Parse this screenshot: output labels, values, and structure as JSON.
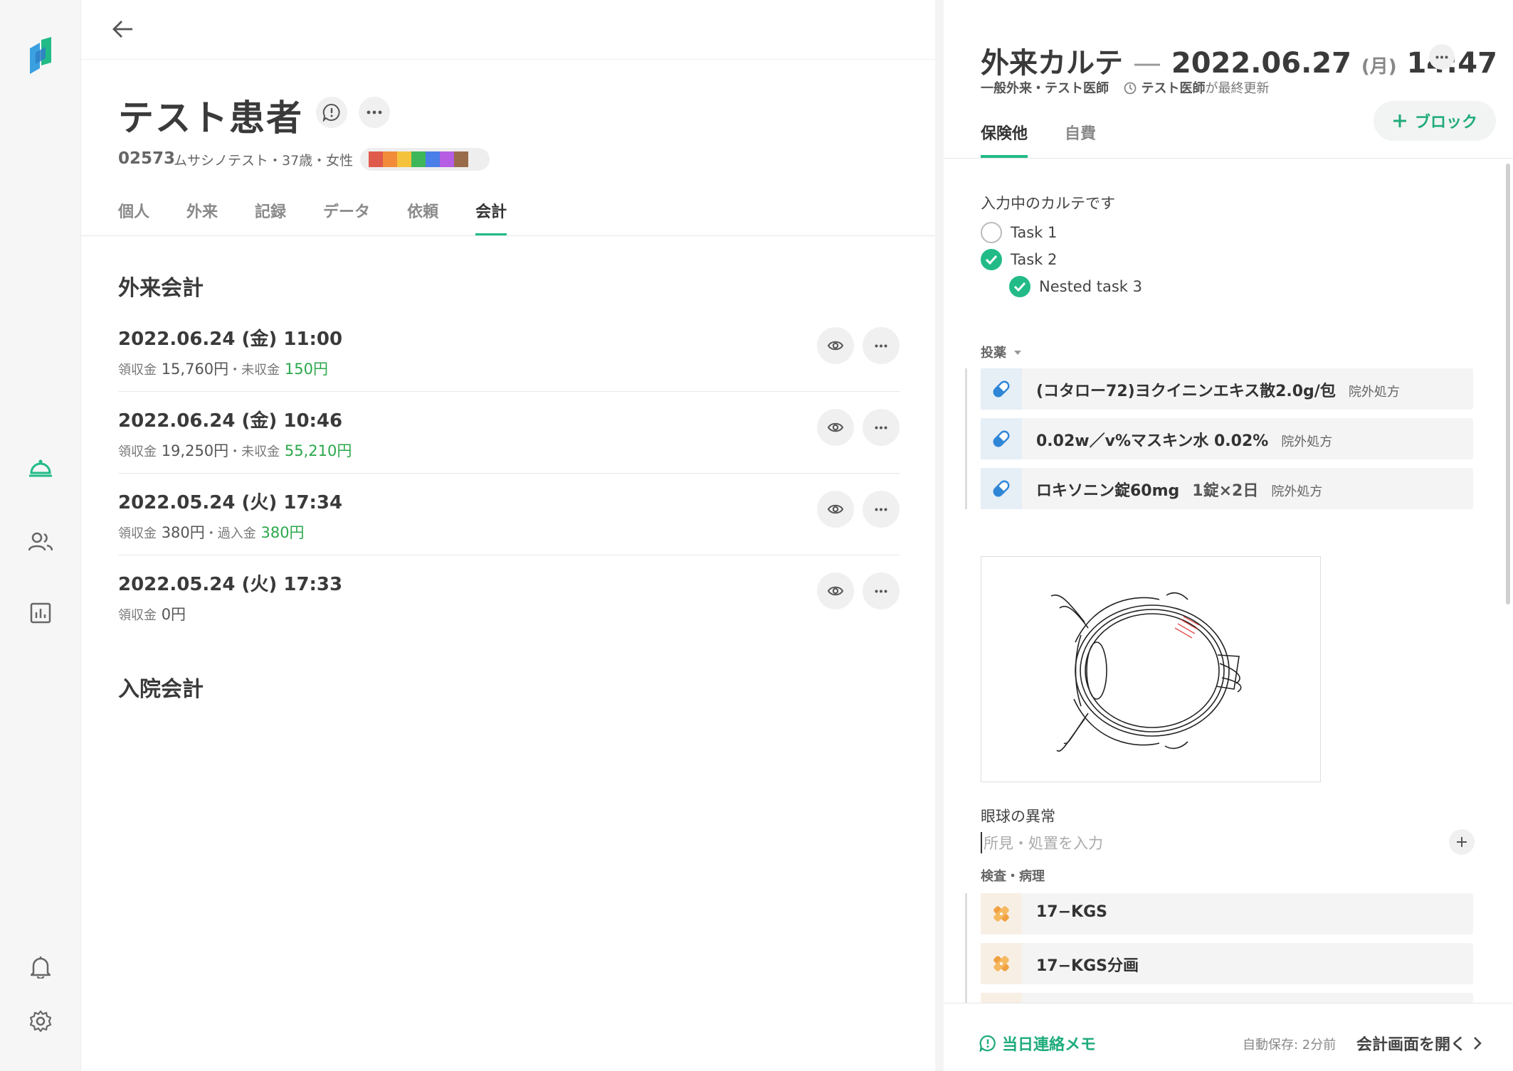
{
  "colors": {
    "accent": "#22bb88",
    "green_amount": "#2aa84a",
    "tags": [
      "#e05a4c",
      "#f28c3a",
      "#f5c23c",
      "#3db75a",
      "#4a7ee8",
      "#b55de3",
      "#9a6b4a"
    ]
  },
  "sidebar": {
    "icons": [
      "logo-icon",
      "bell-tray-icon",
      "people-icon",
      "chart-icon",
      "notification-icon",
      "settings-icon"
    ]
  },
  "patient": {
    "name": "テスト患者",
    "id": "02573",
    "info": "ムサシノテスト・37歳・女性",
    "tabs": [
      "個人",
      "外来",
      "記録",
      "データ",
      "依頼",
      "会計"
    ],
    "active_tab": "会計"
  },
  "outpatient": {
    "title": "外来会計",
    "entries": [
      {
        "date": "2022.06.24 (金) 11:00",
        "received_label": "領収金",
        "received": "15,760円",
        "sep": "・",
        "other_label": "未収金",
        "other": "150円"
      },
      {
        "date": "2022.06.24 (金) 10:46",
        "received_label": "領収金",
        "received": "19,250円",
        "sep": "・",
        "other_label": "未収金",
        "other": "55,210円"
      },
      {
        "date": "2022.05.24 (火) 17:34",
        "received_label": "領収金",
        "received": "380円",
        "sep": "・",
        "other_label": "過入金",
        "other": "380円"
      },
      {
        "date": "2022.05.24 (火) 17:33",
        "received_label": "領収金",
        "received": "0円",
        "sep": "",
        "other_label": "",
        "other": ""
      }
    ]
  },
  "inpatient": {
    "title": "入院会計"
  },
  "chart": {
    "title_prefix": "外来カルテ",
    "dash": "—",
    "date": "2022.06.27",
    "weekday": "(月)",
    "time": "14:47",
    "meta_dept": "一般外来・テスト医師",
    "meta_updater": "テスト医師",
    "meta_suffix": "が最終更新",
    "tabs": [
      "保険他",
      "自費"
    ],
    "block_label": "ブロック",
    "note_title": "入力中のカルテです",
    "tasks": [
      {
        "label": "Task 1",
        "checked": false
      },
      {
        "label": "Task 2",
        "checked": true
      },
      {
        "label": "Nested task 3",
        "checked": true
      }
    ],
    "meds_label": "投薬",
    "meds": [
      {
        "name": "(コタロー72)ヨクイニンエキス散2.0g/包",
        "dose": "",
        "tag": "院外処方"
      },
      {
        "name": "0.02w／v%マスキン水 0.02%",
        "dose": "",
        "tag": "院外処方"
      },
      {
        "name": "ロキソニン錠60mg",
        "dose": "1錠×2日",
        "tag": "院外処方"
      }
    ],
    "eye_title": "眼球の異常",
    "eye_placeholder": "所見・処置を入力",
    "exam_label": "検査・病理",
    "exams": [
      "17−KGS",
      "17−KGS分画"
    ],
    "footer": {
      "memo": "当日連絡メモ",
      "autosave": "自動保存: 2分前",
      "open_account": "会計画面を開く"
    }
  }
}
